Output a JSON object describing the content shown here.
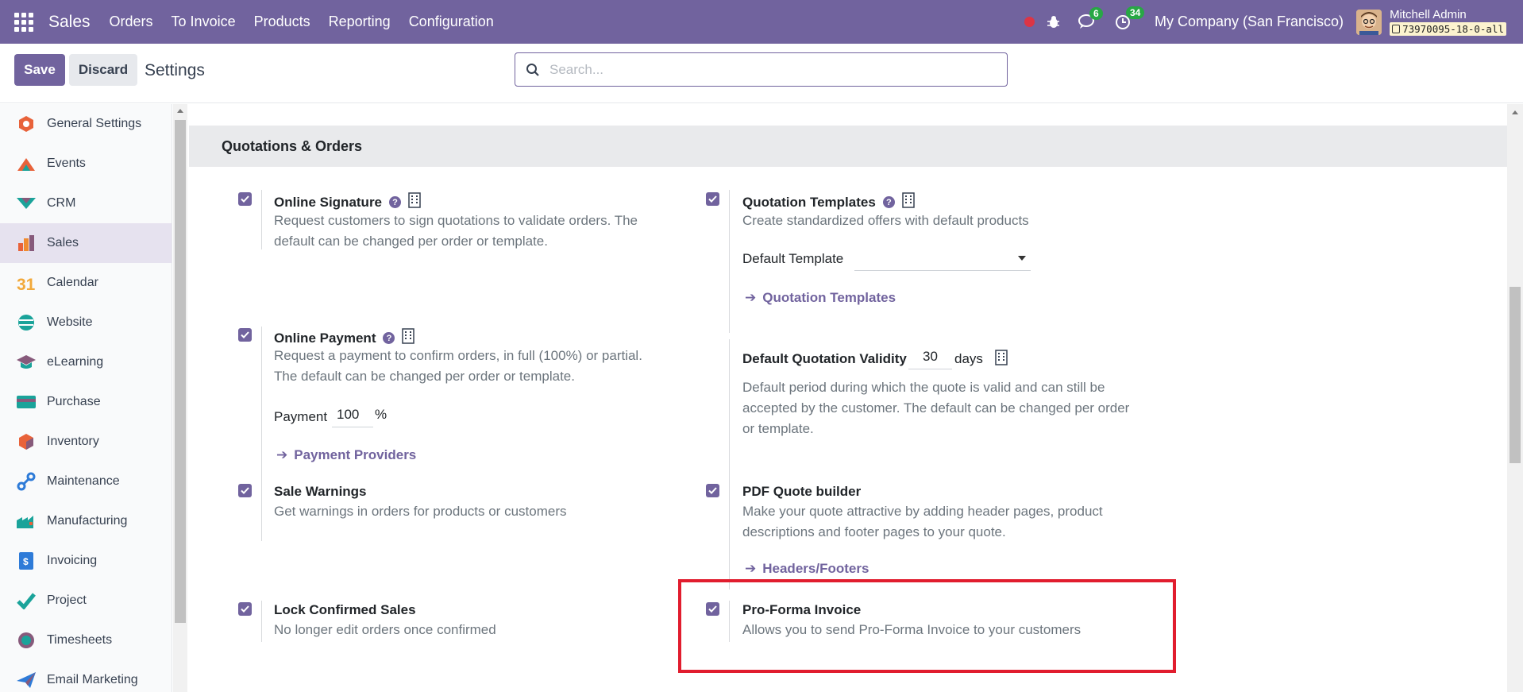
{
  "navbar": {
    "brand": "Sales",
    "menu": [
      "Orders",
      "To Invoice",
      "Products",
      "Reporting",
      "Configuration"
    ],
    "messages_count": "6",
    "activities_count": "34",
    "company": "My Company (San Francisco)",
    "user_name": "Mitchell Admin",
    "database": "73970095-18-0-all"
  },
  "control": {
    "save_label": "Save",
    "discard_label": "Discard",
    "title": "Settings",
    "search_placeholder": "Search..."
  },
  "sidebar": {
    "items": [
      {
        "label": "General Settings",
        "icon": "general-settings-icon",
        "color": "#e8623a"
      },
      {
        "label": "Events",
        "icon": "events-icon",
        "color": "#e8623a"
      },
      {
        "label": "CRM",
        "icon": "crm-icon",
        "color": "#1aa39a"
      },
      {
        "label": "Sales",
        "icon": "sales-icon",
        "color": "#f08b30",
        "active": true
      },
      {
        "label": "Calendar",
        "icon": "calendar-icon",
        "color": "#f2a93b"
      },
      {
        "label": "Website",
        "icon": "website-icon",
        "color": "#1aa39a"
      },
      {
        "label": "eLearning",
        "icon": "elearning-icon",
        "color": "#875a7b"
      },
      {
        "label": "Purchase",
        "icon": "purchase-icon",
        "color": "#1aa39a"
      },
      {
        "label": "Inventory",
        "icon": "inventory-icon",
        "color": "#e8623a"
      },
      {
        "label": "Maintenance",
        "icon": "maintenance-icon",
        "color": "#2e7bd8"
      },
      {
        "label": "Manufacturing",
        "icon": "manufacturing-icon",
        "color": "#1aa39a"
      },
      {
        "label": "Invoicing",
        "icon": "invoicing-icon",
        "color": "#2e7bd8"
      },
      {
        "label": "Project",
        "icon": "project-icon",
        "color": "#1aa39a"
      },
      {
        "label": "Timesheets",
        "icon": "timesheets-icon",
        "color": "#875a7b"
      },
      {
        "label": "Email Marketing",
        "icon": "email-marketing-icon",
        "color": "#2e7bd8"
      }
    ]
  },
  "section": {
    "title": "Quotations & Orders",
    "settings": {
      "online_signature": {
        "title": "Online Signature",
        "desc1": "Request customers to sign quotations to validate orders. The",
        "desc2": "default can be changed per order or template."
      },
      "quotation_templates": {
        "title": "Quotation Templates",
        "desc": "Create standardized offers with default products",
        "field_label": "Default Template",
        "field_value": "",
        "link": "Quotation Templates"
      },
      "online_payment": {
        "title": "Online Payment",
        "desc1": "Request a payment to confirm orders, in full (100%) or partial.",
        "desc2": "The default can be changed per order or template.",
        "field_label": "Payment",
        "field_value": "100",
        "field_unit": "%",
        "link": "Payment Providers"
      },
      "quotation_validity": {
        "title": "Default Quotation Validity",
        "value": "30",
        "unit": "days",
        "desc1": "Default period during which the quote is valid and can still be",
        "desc2": "accepted by the customer. The default can be changed per order",
        "desc3": "or template."
      },
      "sale_warnings": {
        "title": "Sale Warnings",
        "desc": "Get warnings in orders for products or customers"
      },
      "pdf_quote_builder": {
        "title": "PDF Quote builder",
        "desc1": "Make your quote attractive by adding header pages, product",
        "desc2": "descriptions and footer pages to your quote.",
        "link": "Headers/Footers"
      },
      "lock_confirmed_sales": {
        "title": "Lock Confirmed Sales",
        "desc": "No longer edit orders once confirmed"
      },
      "pro_forma_invoice": {
        "title": "Pro-Forma Invoice",
        "desc": "Allows you to send Pro-Forma Invoice to your customers"
      }
    }
  },
  "colors": {
    "brand": "#71639e",
    "highlight": "#e11d2e"
  }
}
